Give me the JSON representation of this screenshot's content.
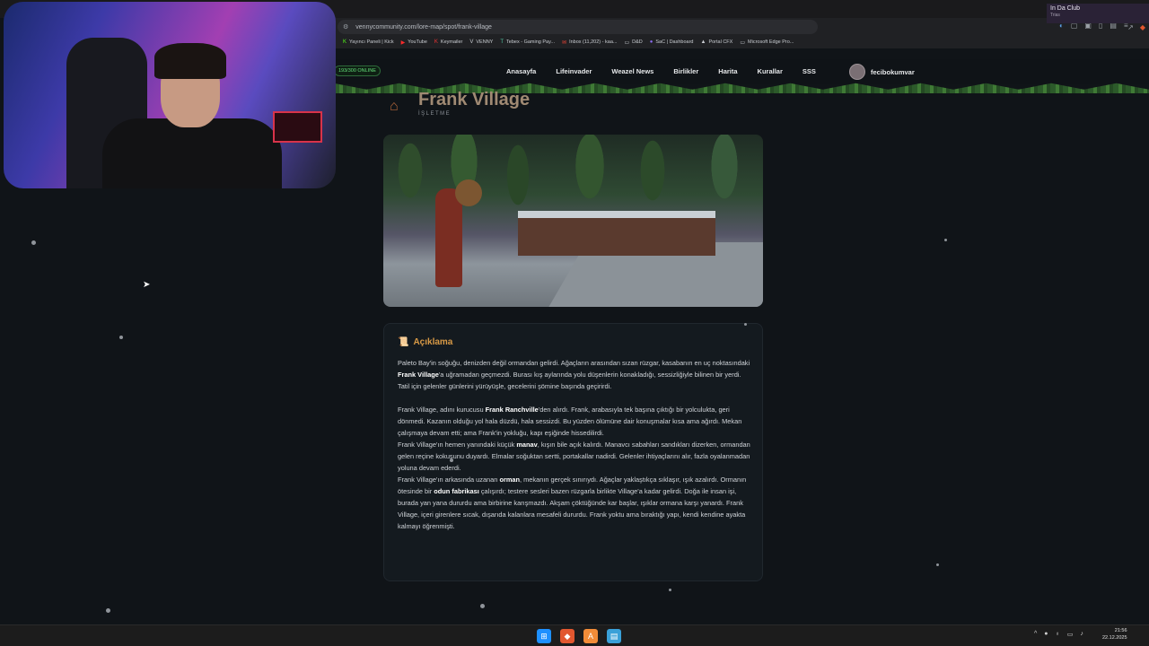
{
  "browser": {
    "url": "vennycommunity.com/lore-map/spot/frank-village",
    "bookmarks": [
      {
        "icon": "K",
        "label": "Yayıncı Paneli | Kick"
      },
      {
        "icon": "▶",
        "label": "YouTube"
      },
      {
        "icon": "K",
        "label": "Keymailer"
      },
      {
        "icon": "V",
        "label": "VENNY"
      },
      {
        "icon": "T",
        "label": "Tebex - Gaming Pay..."
      },
      {
        "icon": "✉",
        "label": "Inbox (11,202) - kaa..."
      },
      {
        "icon": "▭",
        "label": "D&D"
      },
      {
        "icon": "●",
        "label": "SaC | Dashboard"
      },
      {
        "icon": "▲",
        "label": "Portal CFX"
      },
      {
        "icon": "▭",
        "label": "Microsoft Edge Pro..."
      }
    ]
  },
  "notification": {
    "title": "In Da Club",
    "subtitle": "Trias"
  },
  "site": {
    "online_badge": "193/300 ONLINE",
    "nav": [
      "Anasayfa",
      "Lifeinvader",
      "Weazel News",
      "Birlikler",
      "Harita",
      "Kurallar",
      "SSS"
    ],
    "username": "fecibokumvar"
  },
  "page": {
    "title": "Frank Village",
    "subtitle": "İŞLETME"
  },
  "description": {
    "heading": "Açıklama",
    "p1_a": "Paleto Bay'in soğuğu, denizden değil ormandan gelirdi. Ağaçların arasından sızan rüzgar, kasabanın en uç noktasındaki ",
    "p1_b": "Frank Village",
    "p1_c": "'a uğramadan geçmezdi. Burası kış aylarında yolu düşenlerin konakladığı, sessizliğiyle bilinen bir yerdi. Tatil için gelenler günlerini yürüyüşle, gecelerini şömine başında geçirirdi.",
    "p2_a": "Frank Village, adını kurucusu ",
    "p2_b": "Frank Ranchville",
    "p2_c": "'den alırdı. Frank, arabasıyla tek başına çıktığı bir yolculukta, geri dönmedi. Kazanın olduğu yol hala düzdü, hala sessizdi. Bu yüzden ölümüne dair konuşmalar kısa ama ağırdı. Mekan çalışmaya devam etti; ama Frank'in yokluğu, kapı eşiğinde hissedilirdi.",
    "p3_a": "Frank Village'ın hemen yanındaki küçük ",
    "p3_b": "manav",
    "p3_c": ", kışın bile açık kalırdı. Manavcı sabahları sandıkları dizerken, ormandan gelen reçine kokusunu duyardı. Elmalar soğuktan sertti, portakallar nadirdi. Gelenler ihtiyaçlarını alır, fazla oyalanmadan yoluna devam ederdi.",
    "p4_a": "Frank Village'ın arkasında uzanan ",
    "p4_b": "orman",
    "p4_c": ", mekanın gerçek sınırıydı. Ağaçlar yaklaştıkça sıklaşır, ışık azalırdı. Ormanın ötesinde bir ",
    "p4_d": "odun fabrikası",
    "p4_e": " çalışırdı; testere sesleri bazen rüzgarla birlikte Village'a kadar gelirdi. Doğa ile insan işi, burada yan yana dururdu ama birbirine karışmazdı. Akşam çöktüğünde kar başlar, ışıklar ormana karşı yanardı. Frank Village, içeri girenlere sıcak, dışarıda kalanlara mesafeli dururdu. Frank yoktu ama bıraktığı yapı, kendi kendine ayakta kalmayı öğrenmişti."
  },
  "taskbar": {
    "clock_time": "21:56",
    "clock_date": "22.12.2025"
  }
}
